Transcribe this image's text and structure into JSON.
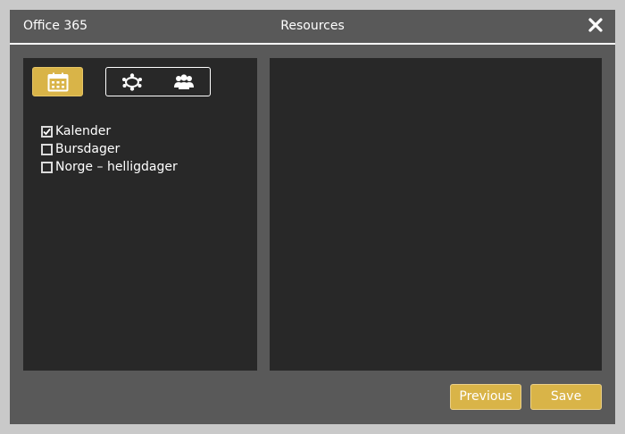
{
  "header": {
    "app_title": "Office 365",
    "dialog_title": "Resources",
    "close_icon": "close-icon"
  },
  "toolbar": {
    "calendar_icon": "calendar-icon",
    "rooms_icon": "rooms-icon",
    "people_icon": "people-group-icon"
  },
  "calendars": [
    {
      "label": "Kalender",
      "checked": true
    },
    {
      "label": "Bursdager",
      "checked": false
    },
    {
      "label": "Norge – helligdager",
      "checked": false
    }
  ],
  "footer": {
    "previous_label": "Previous",
    "save_label": "Save"
  },
  "colors": {
    "accent": "#d9b448",
    "panel": "#282828",
    "dialog": "#595959"
  }
}
